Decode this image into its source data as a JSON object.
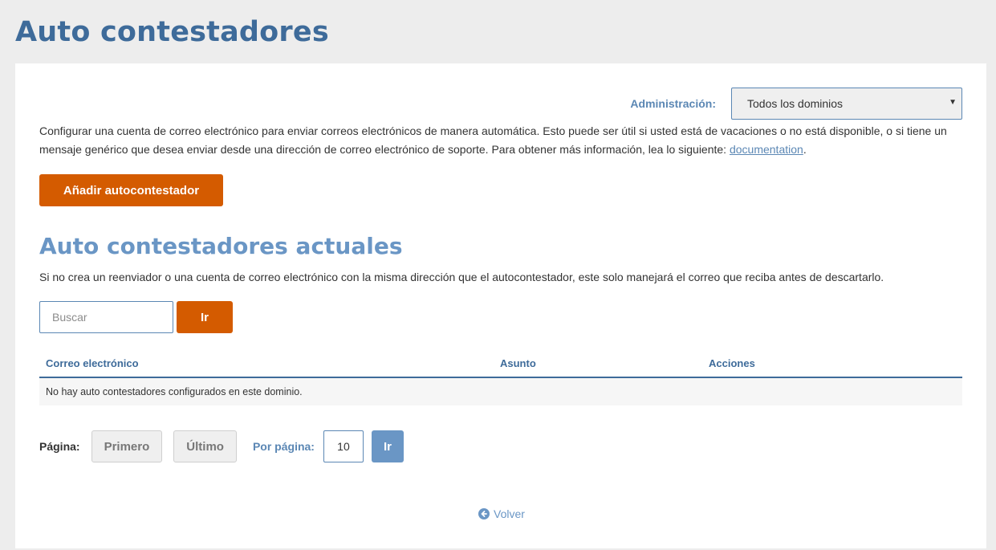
{
  "page": {
    "title": "Auto contestadores"
  },
  "admin": {
    "label": "Administración:",
    "selected_domain": "Todos los dominios"
  },
  "intro": {
    "text": "Configurar una cuenta de correo electrónico para enviar correos electrónicos de manera automática. Esto puede ser útil si usted está de vacaciones o no está disponible, o si tiene un mensaje genérico que desea enviar desde una dirección de correo electrónico de soporte. Para obtener más información, lea lo siguiente: ",
    "link_text": "documentation",
    "suffix": "."
  },
  "actions": {
    "add_label": "Añadir autocontestador"
  },
  "current": {
    "title": "Auto contestadores actuales",
    "description": "Si no crea un reenviador o una cuenta de correo electrónico con la misma dirección que el autocontestador, este solo manejará el correo que reciba antes de descartarlo."
  },
  "search": {
    "placeholder": "Buscar",
    "go_label": "Ir"
  },
  "table": {
    "columns": [
      "Correo electrónico",
      "Asunto",
      "Acciones"
    ],
    "empty_message": "No hay auto contestadores configurados en este dominio."
  },
  "pagination": {
    "page_label": "Página:",
    "first_label": "Primero",
    "last_label": "Último",
    "per_page_label": "Por página:",
    "per_page_value": "10",
    "go_label": "Ir"
  },
  "back": {
    "label": "Volver"
  },
  "colors": {
    "primary_blue": "#3e6b9a",
    "light_blue": "#6a96c5",
    "accent_orange": "#d45b00",
    "background": "#ededed"
  },
  "icons": {
    "select_caret": "chevron-down-icon",
    "back": "arrow-left-circle-icon"
  }
}
